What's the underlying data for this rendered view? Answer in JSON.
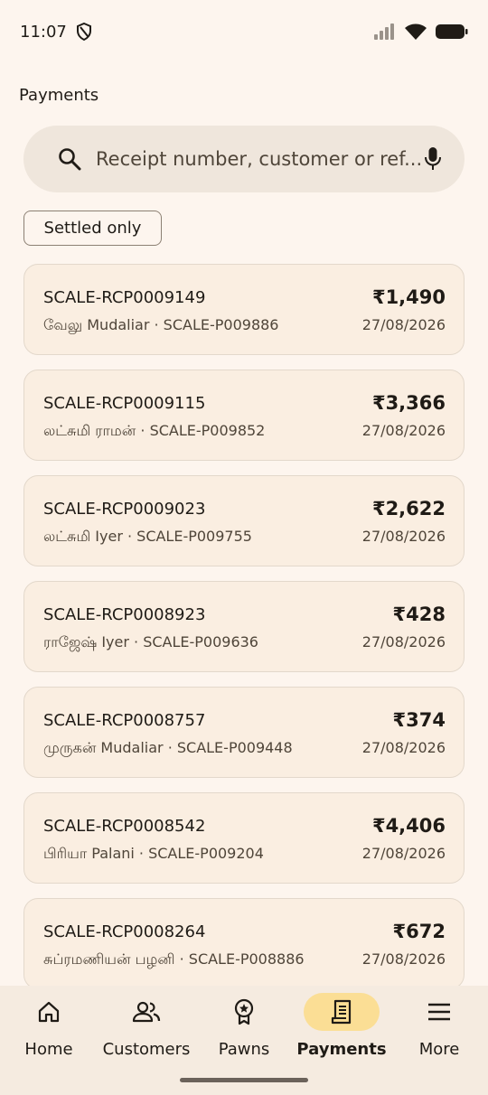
{
  "status": {
    "time": "11:07"
  },
  "header": {
    "title": "Payments"
  },
  "search": {
    "placeholder": "Receipt number, customer or ref..."
  },
  "filter": {
    "chip_label": "Settled only"
  },
  "payments": [
    {
      "receipt": "SCALE-RCP0009149",
      "customer": "வேலு Mudaliar · SCALE-P009886",
      "amount": "₹1,490",
      "date": "27/08/2026"
    },
    {
      "receipt": "SCALE-RCP0009115",
      "customer": "லட்சுமி ராமன் · SCALE-P009852",
      "amount": "₹3,366",
      "date": "27/08/2026"
    },
    {
      "receipt": "SCALE-RCP0009023",
      "customer": "லட்சுமி Iyer · SCALE-P009755",
      "amount": "₹2,622",
      "date": "27/08/2026"
    },
    {
      "receipt": "SCALE-RCP0008923",
      "customer": "ராஜேஷ் Iyer · SCALE-P009636",
      "amount": "₹428",
      "date": "27/08/2026"
    },
    {
      "receipt": "SCALE-RCP0008757",
      "customer": "முருகன் Mudaliar · SCALE-P009448",
      "amount": "₹374",
      "date": "27/08/2026"
    },
    {
      "receipt": "SCALE-RCP0008542",
      "customer": "பிரியா Palani · SCALE-P009204",
      "amount": "₹4,406",
      "date": "27/08/2026"
    },
    {
      "receipt": "SCALE-RCP0008264",
      "customer": "சுப்ரமணியன் பழனி · SCALE-P008886",
      "amount": "₹672",
      "date": "27/08/2026"
    }
  ],
  "nav": {
    "items": [
      {
        "label": "Home",
        "icon": "home-icon"
      },
      {
        "label": "Customers",
        "icon": "people-icon"
      },
      {
        "label": "Pawns",
        "icon": "badge-icon"
      },
      {
        "label": "Payments",
        "icon": "receipt-icon"
      },
      {
        "label": "More",
        "icon": "menu-icon"
      }
    ],
    "active": "Payments"
  },
  "colors": {
    "background": "#fdf5ee",
    "card": "#faeee1",
    "active_pill": "#fbde95",
    "search_bg": "#efe6dc"
  }
}
